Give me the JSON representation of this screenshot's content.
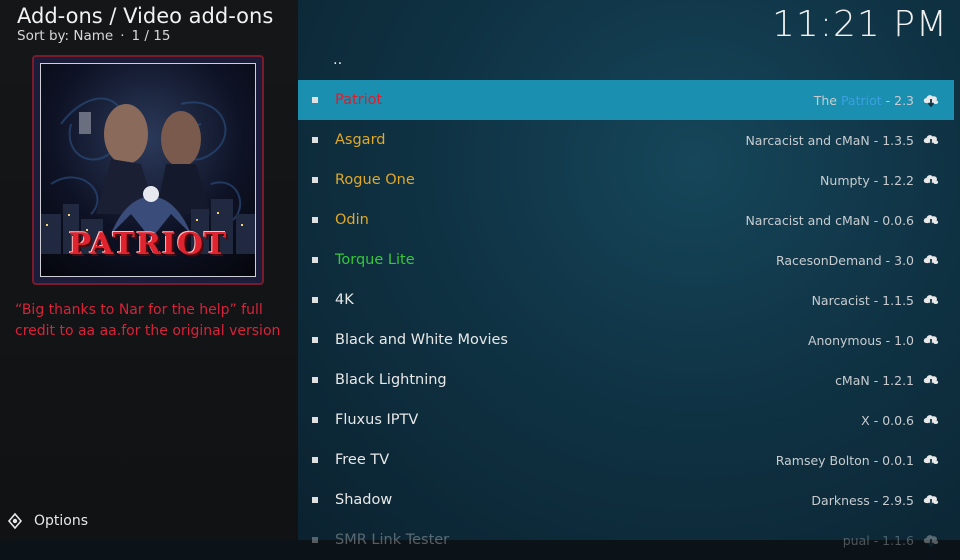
{
  "header": {
    "title": "Add-ons / Video add-ons",
    "sort": "Sort by: Name",
    "sep": "·",
    "position": "1 / 15"
  },
  "clock": "11:21 PM",
  "poster": {
    "text": "PATRIOT"
  },
  "description": "“Big thanks to Nar for the help” full credit to aa aa.for the original version",
  "options_label": "Options",
  "colors": {
    "selected_row": "#1a8fb0",
    "description": "#d8233a",
    "orange_label": "#e3a826",
    "green_label": "#36c83a",
    "red_label": "#e01c2a",
    "highlight": "#3aa0e0"
  },
  "list": {
    "parent": "..",
    "items": [
      {
        "name": "Patriot",
        "meta_prefix": "The ",
        "meta_hl": "Patriot",
        "meta_suffix": " - 2.3",
        "color": "#e01c2a",
        "selected": true
      },
      {
        "name": "Asgard",
        "meta": "Narcacist and cMaN - 1.3.5",
        "color": "#e3a826"
      },
      {
        "name": "Rogue One",
        "meta": "Numpty - 1.2.2",
        "color": "#e3a826"
      },
      {
        "name": "Odin",
        "meta": "Narcacist and cMaN - 0.0.6",
        "color": "#e3a826"
      },
      {
        "name": "Torque Lite",
        "meta": "RacesonDemand - 3.0",
        "color": "#36c83a"
      },
      {
        "name": "4K",
        "meta": "Narcacist - 1.1.5",
        "color": "#e8e8e8"
      },
      {
        "name": "Black and White Movies",
        "meta": "Anonymous - 1.0",
        "color": "#e8e8e8"
      },
      {
        "name": "Black Lightning",
        "meta": "cMaN - 1.2.1",
        "color": "#e8e8e8"
      },
      {
        "name": "Fluxus IPTV",
        "meta": "X - 0.0.6",
        "color": "#e8e8e8"
      },
      {
        "name": "Free TV",
        "meta": "Ramsey Bolton - 0.0.1",
        "color": "#e8e8e8"
      },
      {
        "name": "Shadow",
        "meta": "Darkness - 2.9.5",
        "color": "#e8e8e8"
      },
      {
        "name": "SMR Link Tester",
        "meta": "pual - 1.1.6",
        "color": "#e8e8e8",
        "faded": true
      }
    ]
  }
}
